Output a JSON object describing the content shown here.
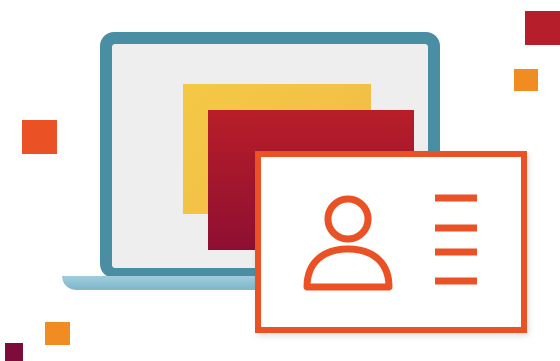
{
  "icons": {
    "laptop": "laptop-icon",
    "id_card": "id-card-icon",
    "avatar": "person-icon",
    "text_lines": "text-lines-icon"
  },
  "colors": {
    "laptop_frame": "#4a8ea4",
    "laptop_screen": "#eeeeee",
    "laptop_base": "#8fc1d3",
    "yellow_window": "#f2bf47",
    "red_window": "#a8182d",
    "card_accent": "#ea5226",
    "confetti_dark_red": "#b61e2b",
    "confetti_orange": "#f08c22",
    "confetti_red_orange": "#ea5226",
    "confetti_maroon": "#7d0c3a"
  }
}
